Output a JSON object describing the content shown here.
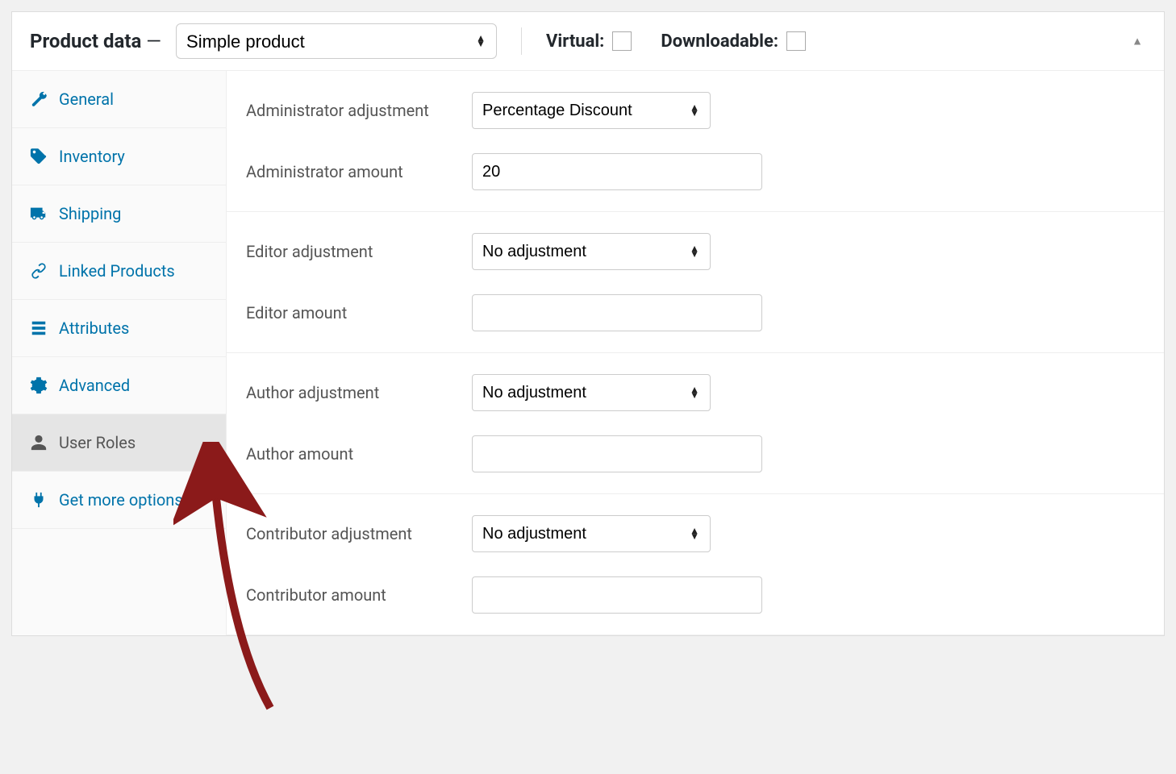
{
  "header": {
    "title": "Product data",
    "dash": "—",
    "product_type": "Simple product",
    "virtual_label": "Virtual:",
    "downloadable_label": "Downloadable:"
  },
  "tabs": [
    {
      "key": "general",
      "label": "General",
      "icon": "wrench"
    },
    {
      "key": "inventory",
      "label": "Inventory",
      "icon": "tag"
    },
    {
      "key": "shipping",
      "label": "Shipping",
      "icon": "truck"
    },
    {
      "key": "linked",
      "label": "Linked Products",
      "icon": "link"
    },
    {
      "key": "attributes",
      "label": "Attributes",
      "icon": "list"
    },
    {
      "key": "advanced",
      "label": "Advanced",
      "icon": "gear"
    },
    {
      "key": "user_roles",
      "label": "User Roles",
      "icon": "user",
      "active": true
    },
    {
      "key": "get_more",
      "label": "Get more options",
      "icon": "plug"
    }
  ],
  "roles": [
    {
      "name": "Administrator",
      "adjustment_label": "Administrator adjustment",
      "adjustment_value": "Percentage Discount",
      "amount_label": "Administrator amount",
      "amount_value": "20"
    },
    {
      "name": "Editor",
      "adjustment_label": "Editor adjustment",
      "adjustment_value": "No adjustment",
      "amount_label": "Editor amount",
      "amount_value": ""
    },
    {
      "name": "Author",
      "adjustment_label": "Author adjustment",
      "adjustment_value": "No adjustment",
      "amount_label": "Author amount",
      "amount_value": ""
    },
    {
      "name": "Contributor",
      "adjustment_label": "Contributor adjustment",
      "adjustment_value": "No adjustment",
      "amount_label": "Contributor amount",
      "amount_value": ""
    }
  ]
}
